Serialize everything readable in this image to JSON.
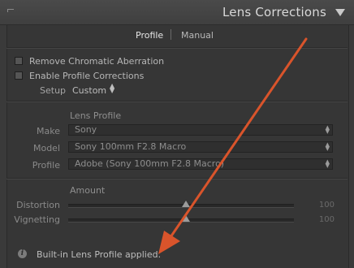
{
  "panel": {
    "title": "Lens Corrections"
  },
  "tabs": [
    {
      "label": "Profile",
      "active": true
    },
    {
      "label": "Manual",
      "active": false
    }
  ],
  "options": {
    "remove_ca": {
      "label": "Remove Chromatic Aberration",
      "checked": false
    },
    "enable_profile": {
      "label": "Enable Profile Corrections",
      "checked": false
    }
  },
  "setup": {
    "label": "Setup",
    "value": "Custom"
  },
  "lens_profile": {
    "heading": "Lens Profile",
    "make": {
      "label": "Make",
      "value": "Sony"
    },
    "model": {
      "label": "Model",
      "value": "Sony 100mm F2.8 Macro"
    },
    "profile": {
      "label": "Profile",
      "value": "Adobe (Sony 100mm F2.8 Macro)"
    }
  },
  "amount": {
    "heading": "Amount",
    "distortion": {
      "label": "Distortion",
      "value": "100",
      "level": 0.5
    },
    "vignetting": {
      "label": "Vignetting",
      "value": "100",
      "level": 0.5
    }
  },
  "status": {
    "icon": "info-icon",
    "text": "Built-in Lens Profile applied."
  },
  "colors": {
    "annotation_arrow": "#d9542b",
    "panel_bg": "#363636",
    "header_bg": "#444444"
  }
}
